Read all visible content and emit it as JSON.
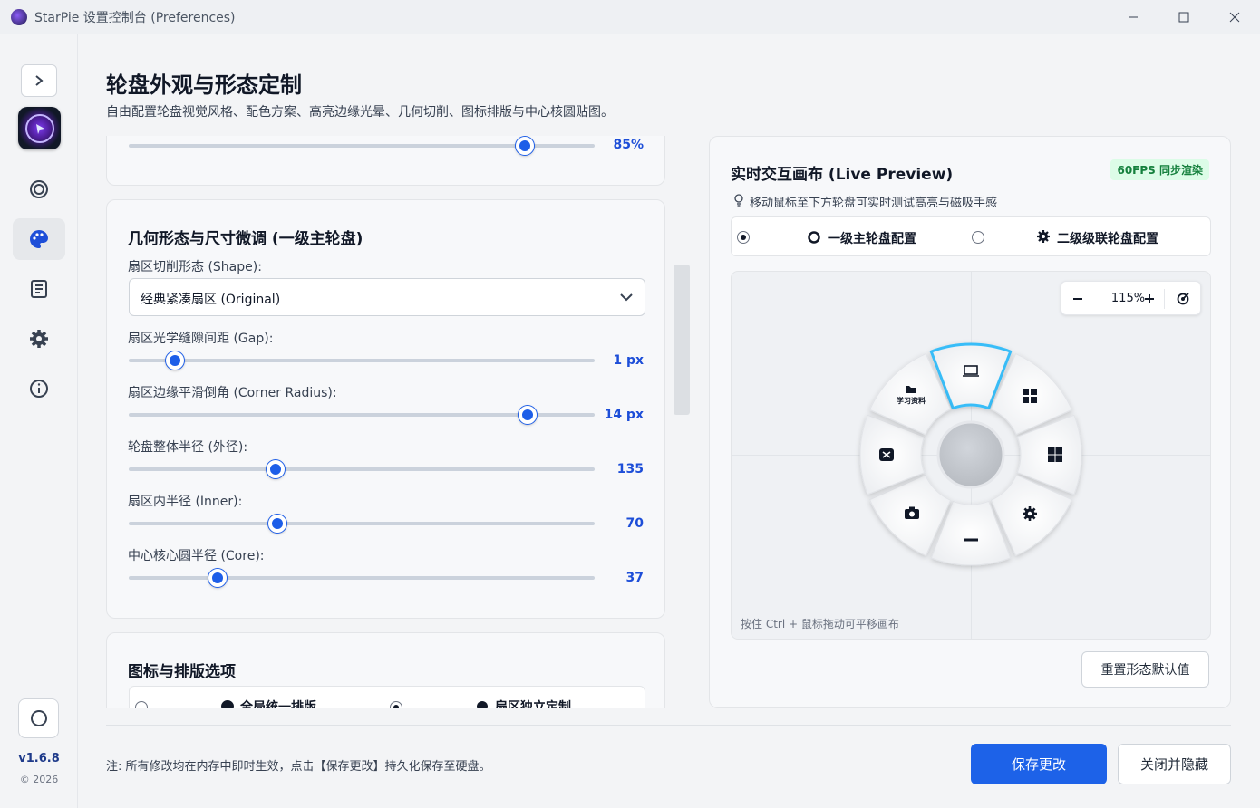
{
  "window": {
    "title": "StarPie 设置控制台 (Preferences)",
    "minimize": "—",
    "maximize": "☐",
    "close": "✕"
  },
  "sidebar": {
    "version": "v1.6.8",
    "year": "© 2026",
    "items": [
      {
        "icon": "target-icon"
      },
      {
        "icon": "palette-icon",
        "active": true
      },
      {
        "icon": "document-icon"
      },
      {
        "icon": "gear-icon"
      },
      {
        "icon": "info-icon"
      }
    ]
  },
  "header": {
    "title": "轮盘外观与形态定制",
    "subtitle": "自由配置轮盘视觉风格、配色方案、高亮边缘光晕、几何切削、图标排版与中心核圆贴图。"
  },
  "top_slider": {
    "value_text": "85%",
    "fraction": 0.85
  },
  "geometry": {
    "title": "几何形态与尺寸微调 (一级主轮盘)",
    "shape_label": "扇区切削形态 (Shape):",
    "shape_value": "经典紧凑扇区 (Original)",
    "sliders": [
      {
        "label": "扇区光学缝隙间距 (Gap):",
        "value_text": "1 px",
        "fraction": 0.1
      },
      {
        "label": "扇区边缘平滑倒角 (Corner Radius):",
        "value_text": "14 px",
        "fraction": 0.857
      },
      {
        "label": "轮盘整体半径 (外径):",
        "value_text": "135",
        "fraction": 0.315
      },
      {
        "label": "扇区内半径 (Inner):",
        "value_text": "70",
        "fraction": 0.32
      },
      {
        "label": "中心核心圆半径 (Core):",
        "value_text": "37",
        "fraction": 0.19
      }
    ]
  },
  "icons_section": {
    "title": "图标与排版选项",
    "option1": "全局统一排版",
    "option2": "扇区独立定制"
  },
  "preview": {
    "title": "实时交互画布 (Live Preview)",
    "badge": "60FPS 同步渲染",
    "hint": "移动鼠标至下方轮盘可实时测试高亮与磁吸手感",
    "tab1": "一级主轮盘配置",
    "tab2": "二级级联轮盘配置",
    "zoom": "115%",
    "canvas_note": "按住 Ctrl + 鼠标拖动可平移画布",
    "reset": "重置形态默认值",
    "folder_label": "学习资料"
  },
  "footer": {
    "note": "注: 所有修改均在内存中即时生效，点击【保存更改】持久化保存至硬盘。",
    "save": "保存更改",
    "close": "关闭并隐藏"
  },
  "colors": {
    "accent": "#1d62e8",
    "badge_green": "#15803d",
    "highlight": "#38bdf8"
  }
}
